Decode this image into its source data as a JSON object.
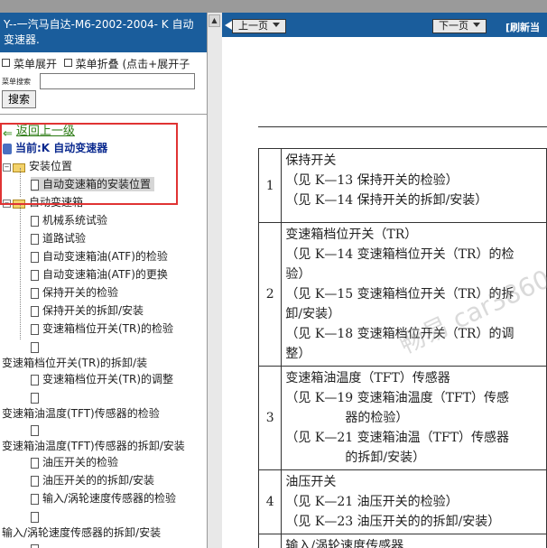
{
  "left_panel": {
    "title": "Y--一汽马自达-M6-2002-2004- K 自动变速器.",
    "menu_expand": "菜单展开",
    "menu_collapse": "菜单折叠 (点击+展开子",
    "search_label": "菜单搜索",
    "search_placeholder": "",
    "search_button": "搜索",
    "tree": {
      "back": "返回上一级",
      "current": "当前:K 自动变速器",
      "items": [
        "安装位置",
        "自动变速箱的安装位置",
        "自动变速箱",
        "机械系统试验",
        "道路试验",
        "自动变速箱油(ATF)的检验",
        "自动变速箱油(ATF)的更换",
        "保持开关的检验",
        "保持开关的拆卸/安装",
        "变速箱档位开关(TR)的检验",
        "变速箱档位开关(TR)的拆卸/装",
        "变速箱档位开关(TR)的调整",
        "变速箱油温度(TFT)传感器的检验",
        "变速箱油温度(TFT)传感器的拆卸/安装",
        "油压开关的检验",
        "油压开关的的拆卸/安装",
        "输入/涡轮速度传感器的检验",
        "输入/涡轮速度传感器的拆卸/安装"
      ]
    }
  },
  "nav": {
    "prev": "上一页",
    "next": "下一页",
    "refresh": "[刷新当"
  },
  "table": {
    "rows": [
      {
        "num": "1",
        "lines": [
          "保持开关",
          "（见 K—13 保持开关的检验）",
          "（见 K—14 保持开关的拆卸/安装）"
        ]
      },
      {
        "num": "2",
        "lines": [
          "变速箱档位开关（TR）",
          "（见 K—14 变速箱档位开关（TR）的检",
          "验）",
          "（见 K—15 变速箱档位开关（TR）的拆",
          "卸/安装）",
          "（见 K—18 变速箱档位开关（TR）的调",
          "整）"
        ]
      },
      {
        "num": "3",
        "lines": [
          "变速箱油温度（TFT）传感器",
          "（见 K—19 变速箱油温度（TFT）传感",
          "器的检验）",
          "（见 K—21 变速箱油温（TFT）传感器",
          "的拆卸/安装）"
        ]
      },
      {
        "num": "4",
        "lines": [
          "油压开关",
          "（见 K—21 油压开关的检验）",
          "（见 K—23 油压开关的的拆卸/安装）"
        ]
      },
      {
        "num": "5",
        "lines": [
          "输入/涡轮速度传感器"
        ]
      }
    ]
  },
  "watermark": "畅易 car3860.com 65"
}
